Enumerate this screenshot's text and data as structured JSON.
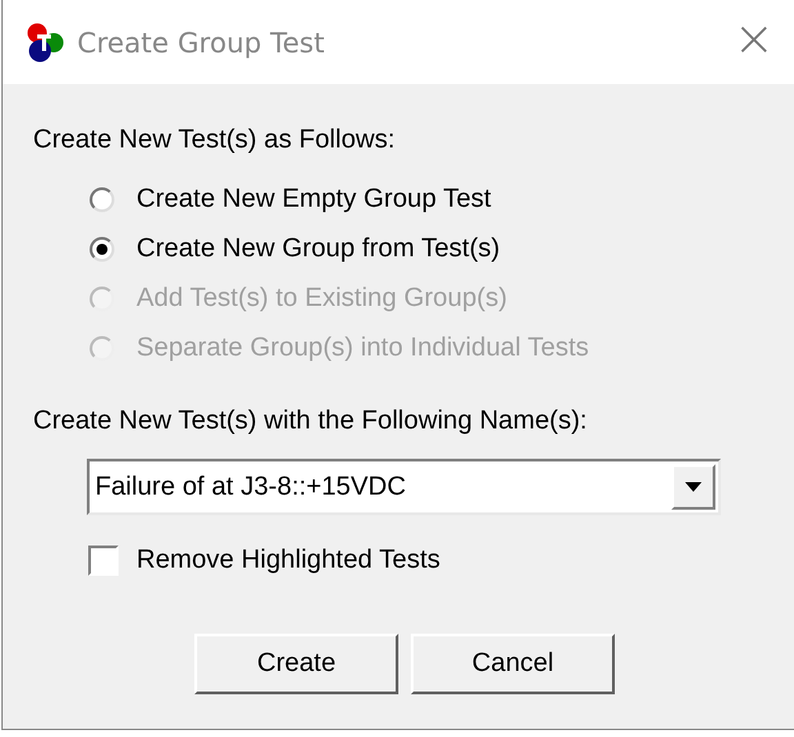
{
  "window": {
    "title": "Create Group Test",
    "close": "×"
  },
  "options_label": "Create New Test(s) as Follows:",
  "options": [
    {
      "label": "Create New Empty Group Test",
      "selected": false,
      "disabled": false
    },
    {
      "label": "Create New Group from Test(s)",
      "selected": true,
      "disabled": false
    },
    {
      "label": "Add Test(s) to Existing Group(s)",
      "selected": false,
      "disabled": true
    },
    {
      "label": "Separate Group(s) into Individual Tests",
      "selected": false,
      "disabled": true
    }
  ],
  "name_label": "Create New Test(s) with the Following Name(s):",
  "name_combo": {
    "value": "Failure of at J3-8::+15VDC"
  },
  "remove_checkbox": {
    "label": "Remove Highlighted Tests",
    "checked": false
  },
  "buttons": [
    "Create",
    "Cancel"
  ]
}
